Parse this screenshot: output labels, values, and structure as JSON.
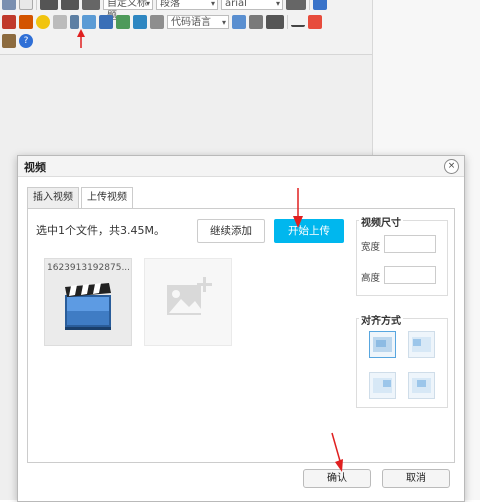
{
  "toolbar": {
    "title_select": "自定义标题",
    "paragraph_select": "段落",
    "font_select": "arial",
    "code_select": "代码语言"
  },
  "dialog": {
    "title": "视频",
    "close_glyph": "×",
    "tabs": [
      {
        "label": "插入视频",
        "active": false
      },
      {
        "label": "上传视频",
        "active": true
      }
    ],
    "upload": {
      "summary": "选中1个文件，共3.45M。",
      "continue_label": "继续添加",
      "start_label": "开始上传",
      "file_name": "1623913192875..."
    },
    "size": {
      "legend": "视频尺寸",
      "width_label": "宽度",
      "height_label": "高度",
      "width_value": "",
      "height_value": ""
    },
    "align": {
      "legend": "对齐方式",
      "options": [
        "none",
        "left",
        "right",
        "center"
      ]
    },
    "footer": {
      "ok_label": "确认",
      "cancel_label": "取消"
    }
  },
  "colors": {
    "accent": "#00b7ee",
    "arrow": "#e02020"
  }
}
